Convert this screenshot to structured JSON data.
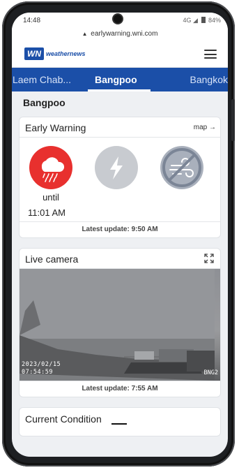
{
  "status_bar": {
    "time": "14:48",
    "signal": "4G",
    "battery": "84%"
  },
  "browser": {
    "url": "earlywarning.wni.com"
  },
  "header": {
    "logo_mark": "WN",
    "logo_text": "weathernews"
  },
  "tabs": [
    {
      "label": "Laem Chab..."
    },
    {
      "label": "Bangpoo"
    },
    {
      "label": "Bangkok"
    }
  ],
  "location_title": "Bangpoo",
  "early_warning": {
    "title": "Early Warning",
    "map_link": "map →",
    "until_label": "until",
    "until_time": "11:01 AM",
    "latest_update": "Latest update: 9:50 AM",
    "colors": {
      "rain": "#e8302e",
      "lightning": "#c8cbd0",
      "wind": "#a9b0bc"
    },
    "icons": [
      "heavy-rain-icon",
      "lightning-icon",
      "wind-disabled-icon"
    ]
  },
  "live_camera": {
    "title": "Live camera",
    "date": "2023/02/15",
    "time": "07:54:59",
    "camera_id": "BNG2",
    "latest_update": "Latest update: 7:55 AM"
  },
  "current_condition": {
    "title": "Current Condition"
  },
  "colors": {
    "accent": "#1b4fa8"
  }
}
